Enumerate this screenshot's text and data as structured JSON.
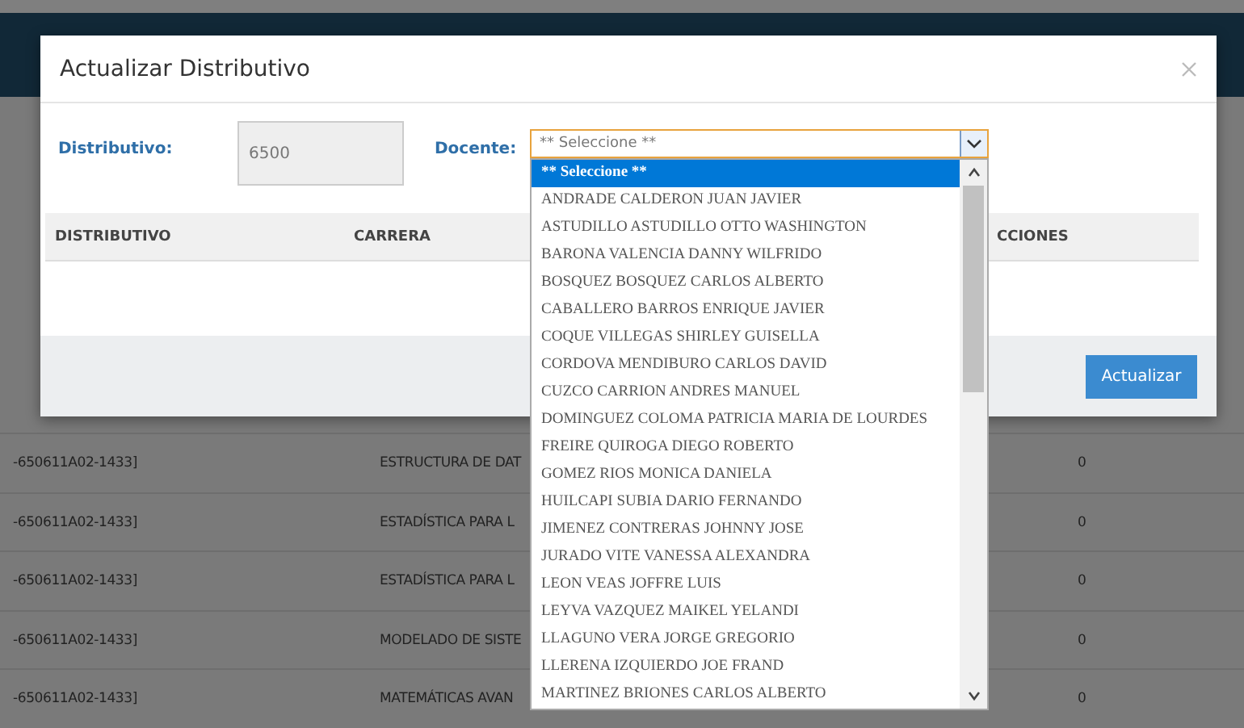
{
  "background_table": {
    "rows": [
      {
        "code": "-650611A02-1433]",
        "course": "ESTRUCTURA DE DAT",
        "total": "0"
      },
      {
        "code": "-650611A02-1433]",
        "course": "ESTADÍSTICA PARA L",
        "total": "0"
      },
      {
        "code": "-650611A02-1433]",
        "course": "ESTADÍSTICA PARA L",
        "total": "0"
      },
      {
        "code": "-650611A02-1433]",
        "course": "MODELADO DE SISTE",
        "total": "0"
      },
      {
        "code": "-650611A02-1433]",
        "course": "MATEMÁTICAS AVAN",
        "total": "0"
      }
    ]
  },
  "modal": {
    "title": "Actualizar Distributivo",
    "distributivo": {
      "label": "Distributivo:",
      "value": "6500"
    },
    "docente": {
      "label": "Docente:",
      "value": "** Seleccione **",
      "expanded": true,
      "options": [
        {
          "label": "** Seleccione **",
          "selected": true
        },
        {
          "label": "ANDRADE CALDERON JUAN JAVIER",
          "selected": false
        },
        {
          "label": "ASTUDILLO ASTUDILLO OTTO WASHINGTON",
          "selected": false
        },
        {
          "label": "BARONA VALENCIA DANNY WILFRIDO",
          "selected": false
        },
        {
          "label": "BOSQUEZ BOSQUEZ CARLOS ALBERTO",
          "selected": false
        },
        {
          "label": "CABALLERO BARROS ENRIQUE JAVIER",
          "selected": false
        },
        {
          "label": "COQUE VILLEGAS SHIRLEY GUISELLA",
          "selected": false
        },
        {
          "label": "CORDOVA MENDIBURO CARLOS DAVID",
          "selected": false
        },
        {
          "label": "CUZCO CARRION ANDRES MANUEL",
          "selected": false
        },
        {
          "label": "DOMINGUEZ COLOMA PATRICIA MARIA DE LOURDES",
          "selected": false
        },
        {
          "label": "FREIRE QUIROGA DIEGO ROBERTO",
          "selected": false
        },
        {
          "label": "GOMEZ RIOS MONICA DANIELA",
          "selected": false
        },
        {
          "label": "HUILCAPI SUBIA DARIO FERNANDO",
          "selected": false
        },
        {
          "label": "JIMENEZ CONTRERAS JOHNNY JOSE",
          "selected": false
        },
        {
          "label": "JURADO VITE VANESSA ALEXANDRA",
          "selected": false
        },
        {
          "label": "LEON VEAS JOFFRE LUIS",
          "selected": false
        },
        {
          "label": "LEYVA VAZQUEZ MAIKEL YELANDI",
          "selected": false
        },
        {
          "label": "LLAGUNO VERA JORGE GREGORIO",
          "selected": false
        },
        {
          "label": "LLERENA IZQUIERDO JOE FRAND",
          "selected": false
        },
        {
          "label": "MARTINEZ BRIONES CARLOS ALBERTO",
          "selected": false
        }
      ]
    },
    "table": {
      "columns": [
        "DISTRIBUTIVO",
        "CARRERA",
        "CCIONES"
      ]
    },
    "button": "Actualizar"
  }
}
